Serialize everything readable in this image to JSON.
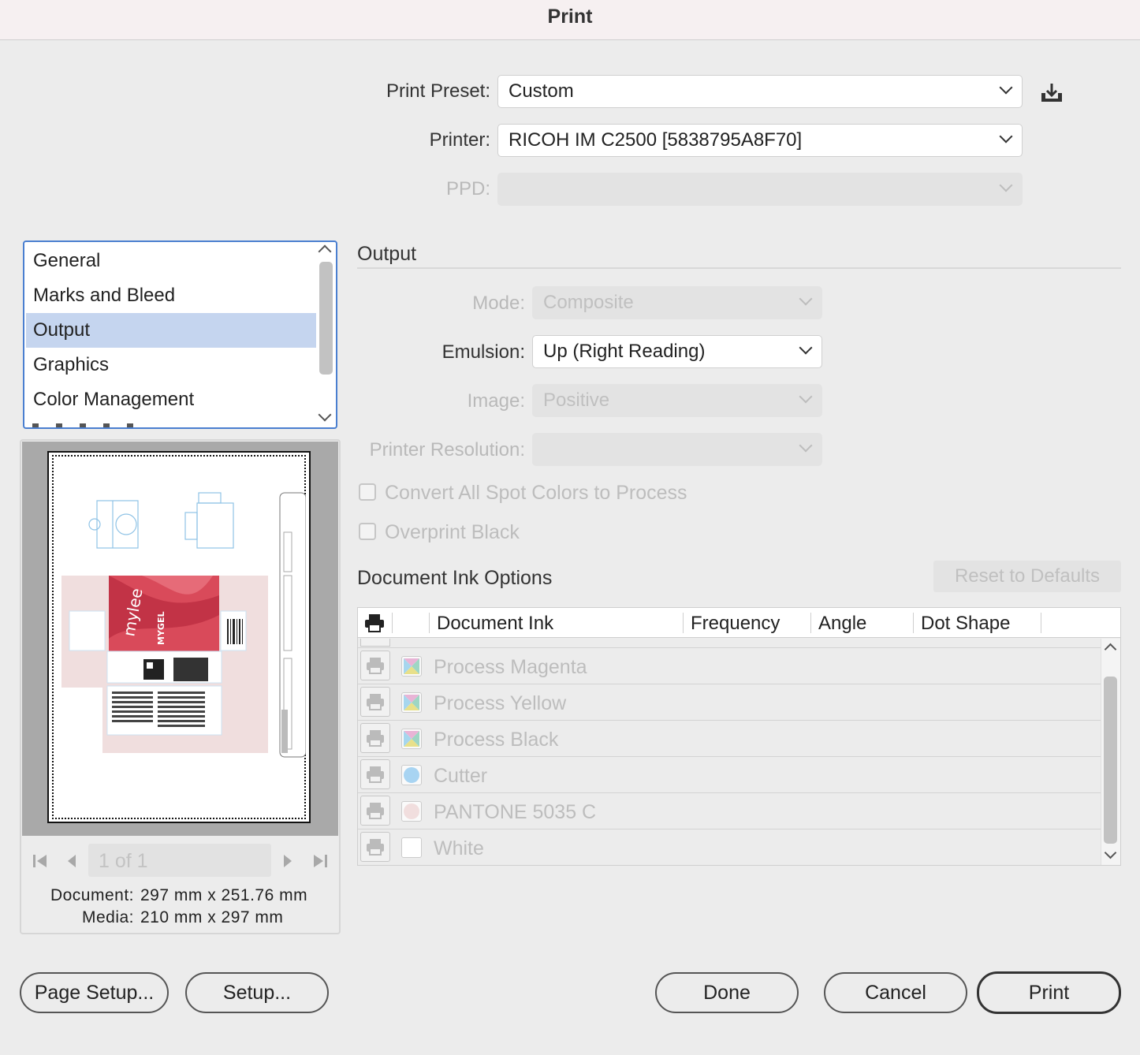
{
  "window": {
    "title": "Print"
  },
  "top_fields": {
    "print_preset": {
      "label": "Print Preset:",
      "value": "Custom"
    },
    "printer": {
      "label": "Printer:",
      "value": "RICOH IM C2500 [5838795A8F70]"
    },
    "ppd": {
      "label": "PPD:",
      "value": ""
    },
    "save_preset_icon": "save-preset-icon"
  },
  "categories": {
    "items": [
      "General",
      "Marks and Bleed",
      "Output",
      "Graphics",
      "Color Management"
    ],
    "selected": "Output"
  },
  "preview": {
    "page_indicator": "1 of 1",
    "document_label": "Document:",
    "document_size": "297 mm x 251.76 mm",
    "media_label": "Media:",
    "media_size": "210 mm x 297 mm"
  },
  "output": {
    "section_title": "Output",
    "mode": {
      "label": "Mode:",
      "value": "Composite",
      "enabled": false
    },
    "emulsion": {
      "label": "Emulsion:",
      "value": "Up (Right Reading)",
      "enabled": true
    },
    "image": {
      "label": "Image:",
      "value": "Positive",
      "enabled": false
    },
    "printer_resolution": {
      "label": "Printer Resolution:",
      "value": "",
      "enabled": false
    },
    "convert_spot": {
      "label": "Convert All Spot Colors to Process",
      "checked": false
    },
    "overprint_black": {
      "label": "Overprint Black",
      "checked": false
    }
  },
  "ink_options": {
    "section_title": "Document Ink Options",
    "reset_label": "Reset to Defaults",
    "columns": [
      "Document Ink",
      "Frequency",
      "Angle",
      "Dot Shape"
    ],
    "rows": [
      {
        "name": "Process Magenta",
        "swatch": "process"
      },
      {
        "name": "Process Yellow",
        "swatch": "process"
      },
      {
        "name": "Process Black",
        "swatch": "process"
      },
      {
        "name": "Cutter",
        "swatch": "#a8d4f2"
      },
      {
        "name": "PANTONE 5035 C",
        "swatch": "#f1dede"
      },
      {
        "name": "White",
        "swatch": "#ffffff"
      }
    ]
  },
  "buttons": {
    "page_setup": "Page Setup...",
    "setup": "Setup...",
    "done": "Done",
    "cancel": "Cancel",
    "print": "Print"
  },
  "artwork_text": {
    "brand": "mylee",
    "product": "MYGEL"
  }
}
